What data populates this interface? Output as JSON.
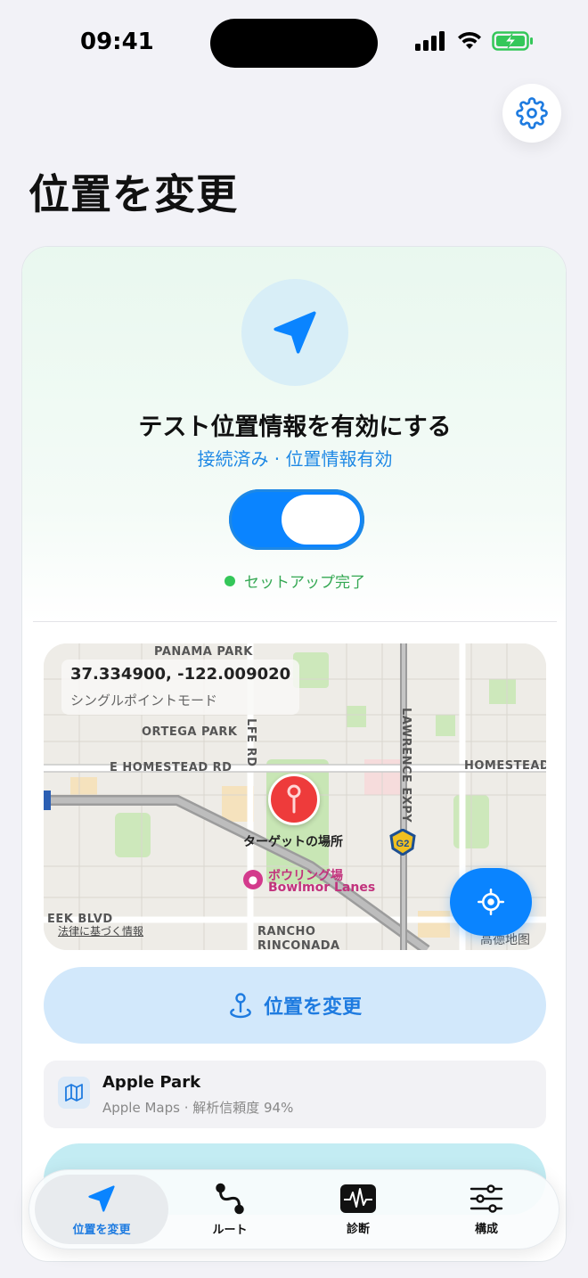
{
  "status_bar": {
    "time": "09:41"
  },
  "header": {
    "title": "位置を変更",
    "settings_icon": "gear-icon"
  },
  "colors": {
    "accent": "#0a84ff",
    "success": "#34c759",
    "pin": "#ee3b3b"
  },
  "mock_location": {
    "title": "テスト位置情報を有効にする",
    "subtitle": "接続済み · 位置情報有効",
    "toggle_on": true,
    "status": "セットアップ完了"
  },
  "map": {
    "coordinates": "37.334900, -122.009020",
    "mode": "シングルポイントモード",
    "labels": {
      "panama_park": "PANAMA PARK",
      "ortega_park": "ORTEGA PARK",
      "homestead_rd": "E HOMESTEAD RD",
      "homestead_right": "HOMESTEAD",
      "lawrence_expy": "LAWRENCE EXPY",
      "lfe_rd": "LFE RD",
      "creek_blvd": "EEK BLVD",
      "rancho": "RANCHO",
      "rinconada": "RINCONADA",
      "g2": "G2"
    },
    "target_label": "ターゲットの場所",
    "poi_name_ja": "ボウリング場",
    "poi_name_en": "Bowlmor Lanes",
    "legal": "法律に基づく情報",
    "attribution": "高德地图"
  },
  "actions": {
    "change_location": "位置を変更"
  },
  "place": {
    "name": "Apple Park",
    "meta": "Apple Maps · 解析信頼度 94%"
  },
  "tabs": [
    {
      "label": "位置を変更",
      "icon": "location-arrow-icon",
      "active": true
    },
    {
      "label": "ルート",
      "icon": "route-icon",
      "active": false
    },
    {
      "label": "診断",
      "icon": "waveform-icon",
      "active": false
    },
    {
      "label": "構成",
      "icon": "sliders-icon",
      "active": false
    }
  ]
}
